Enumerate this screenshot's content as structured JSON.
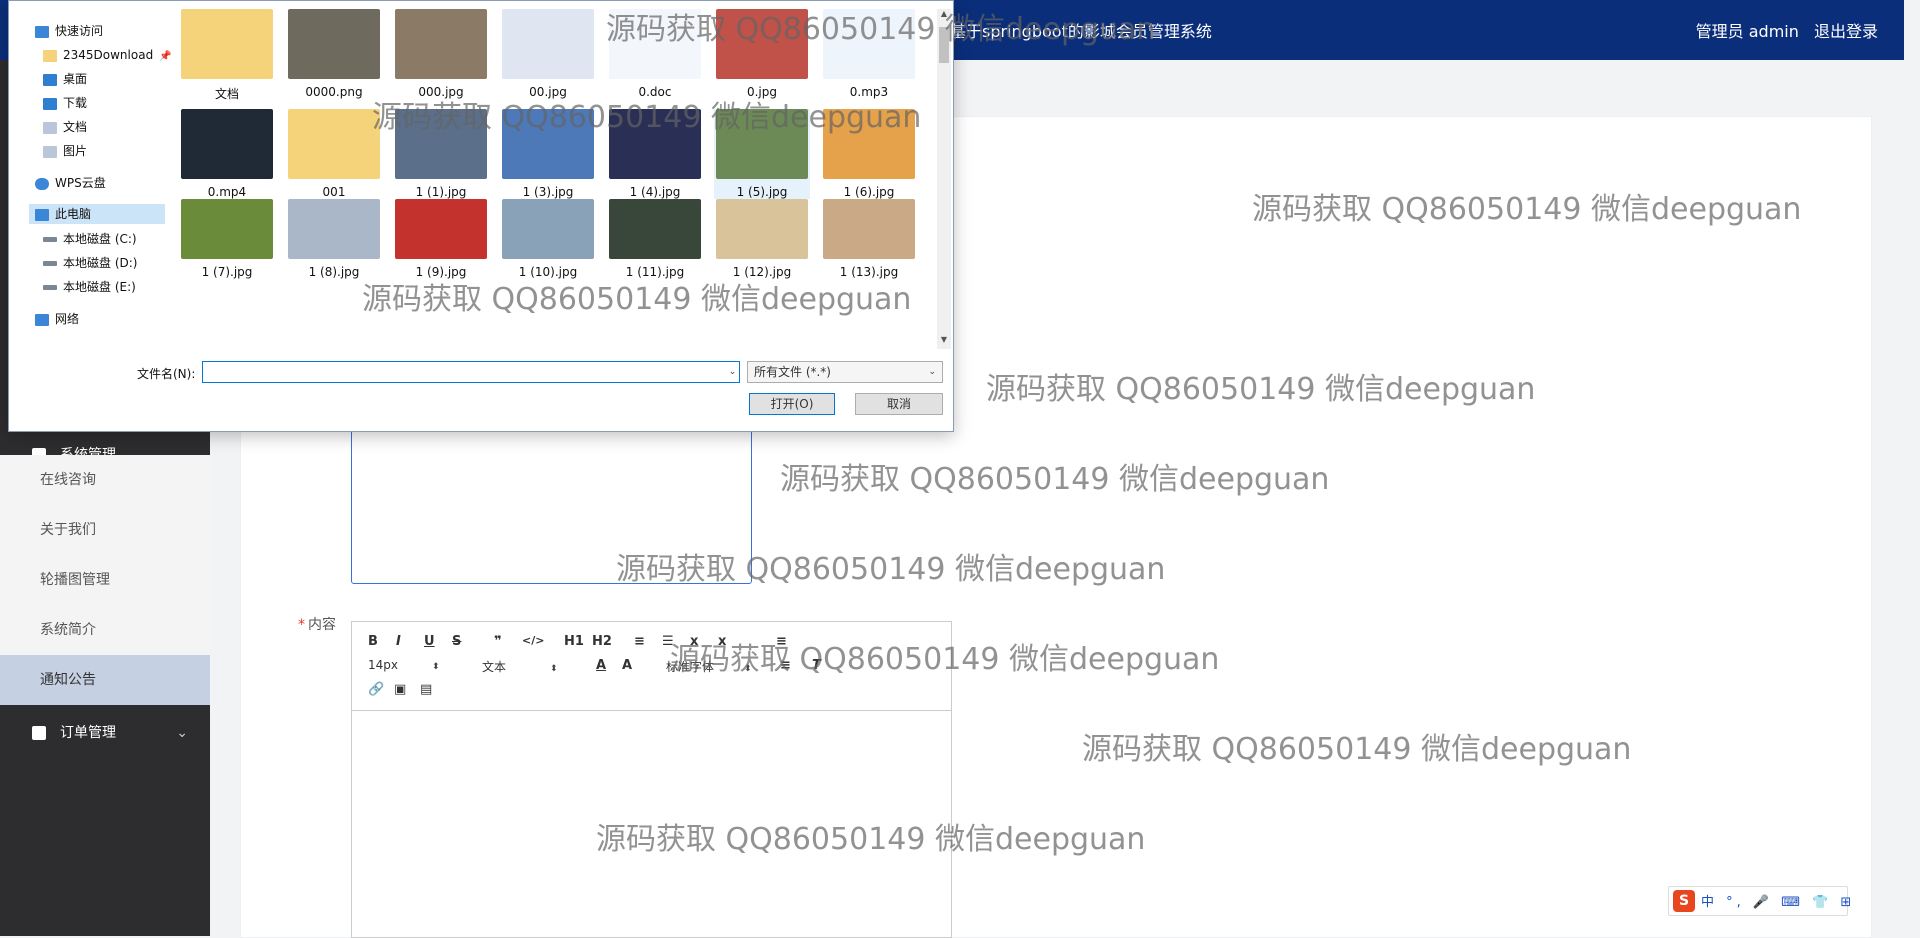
{
  "header": {
    "app_title": "基于springboot的影城会员管理系统",
    "user_label": "管理员 admin",
    "logout_label": "退出登录"
  },
  "sidebar": {
    "partial_group_label": "系统管理",
    "items": [
      {
        "label": "在线咨询"
      },
      {
        "label": "关于我们"
      },
      {
        "label": "轮播图管理"
      },
      {
        "label": "系统简介"
      },
      {
        "label": "通知公告"
      }
    ],
    "order_group_label": "订单管理"
  },
  "form": {
    "content_label": "内容",
    "editor": {
      "font_size": "14px",
      "text_type": "文本",
      "font_family": "标准字体",
      "buttons": [
        "B",
        "I",
        "U",
        "S",
        "❞",
        "</>",
        "H1",
        "H2"
      ]
    }
  },
  "watermark_text": "源码获取 QQ86050149 微信deepguan",
  "dialog": {
    "nav": [
      {
        "label": "快速访问",
        "icon": "star-icon"
      },
      {
        "label": "2345Download",
        "icon": "folder-icon"
      },
      {
        "label": "桌面",
        "icon": "desktop-icon"
      },
      {
        "label": "下载",
        "icon": "download-icon"
      },
      {
        "label": "文档",
        "icon": "document-icon"
      },
      {
        "label": "图片",
        "icon": "picture-icon"
      },
      {
        "label": "WPS云盘",
        "icon": "cloud-icon"
      },
      {
        "label": "此电脑",
        "icon": "computer-icon"
      },
      {
        "label": "本地磁盘 (C:)",
        "icon": "drive-icon"
      },
      {
        "label": "本地磁盘 (D:)",
        "icon": "drive-icon"
      },
      {
        "label": "本地磁盘 (E:)",
        "icon": "drive-icon"
      },
      {
        "label": "网络",
        "icon": "network-icon"
      }
    ],
    "files": [
      {
        "name": "文档",
        "color": "#f4d37a"
      },
      {
        "name": "0000.png",
        "color": "#6f6a5e"
      },
      {
        "name": "000.jpg",
        "color": "#8b7a66"
      },
      {
        "name": "00.jpg",
        "color": "#dfe6f2"
      },
      {
        "name": "0.doc",
        "color": "#f3f6fb"
      },
      {
        "name": "0.jpg",
        "color": "#c0524a"
      },
      {
        "name": "0.mp3",
        "color": "#eef4fb"
      },
      {
        "name": "0.mp4",
        "color": "#1f2a36"
      },
      {
        "name": "001",
        "color": "#f4d37a"
      },
      {
        "name": "1 (1).jpg",
        "color": "#5b6f8a"
      },
      {
        "name": "1 (3).jpg",
        "color": "#4d79b8"
      },
      {
        "name": "1 (4).jpg",
        "color": "#2a2f55"
      },
      {
        "name": "1 (5).jpg",
        "color": "#6c8a56"
      },
      {
        "name": "1 (6).jpg",
        "color": "#e6a24a"
      },
      {
        "name": "1 (7).jpg",
        "color": "#6a8c3a"
      },
      {
        "name": "1 (8).jpg",
        "color": "#a9b7c8"
      },
      {
        "name": "1 (9).jpg",
        "color": "#c4322e"
      },
      {
        "name": "1 (10).jpg",
        "color": "#8aa2b8"
      },
      {
        "name": "1 (11).jpg",
        "color": "#39463a"
      },
      {
        "name": "1 (12).jpg",
        "color": "#d8c39a"
      },
      {
        "name": "1 (13).jpg",
        "color": "#c9a986"
      }
    ],
    "filename_label": "文件名(N):",
    "filename_value": "",
    "filter_label": "所有文件 (*.*)",
    "open_label": "打开(O)",
    "cancel_label": "取消"
  },
  "ime": {
    "logo": "S",
    "rest": "中 °, 🎤 ⌨ 👕 ⊞"
  }
}
